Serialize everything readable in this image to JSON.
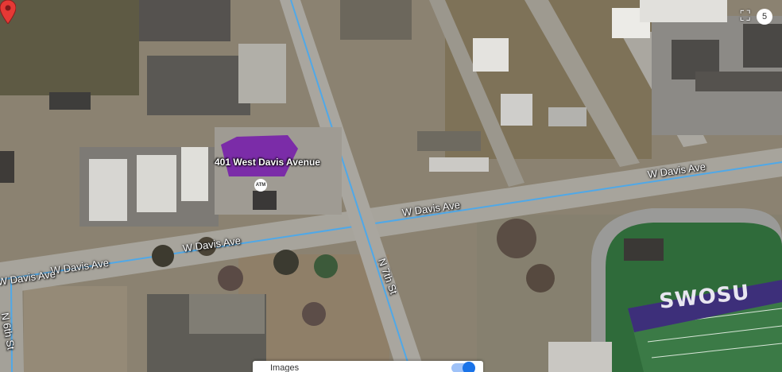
{
  "map": {
    "type": "satellite",
    "pin": {
      "address": "401 West Davis Avenue",
      "color": "#e53935"
    },
    "atm_label": "ATM",
    "streets": [
      {
        "name": "W Davis Ave",
        "id": "w-davis-ave-east"
      },
      {
        "name": "W Davis Ave",
        "id": "w-davis-ave-center"
      },
      {
        "name": "W Davis Ave",
        "id": "w-davis-ave-west"
      },
      {
        "name": "W Davis Ave",
        "id": "w-davis-ave-left-edge"
      },
      {
        "name": "N 7th St",
        "id": "n-7th-st"
      },
      {
        "name": "N 6th St",
        "id": "n-6th-st"
      }
    ],
    "stadium_text": "SWOSU",
    "photo_count": "5",
    "fullscreen_icon": "fullscreen-icon",
    "imagery_label": "Images"
  },
  "colors": {
    "road": "#a7a49c",
    "route_line": "#4fa8e8",
    "field": "#2f6b3a",
    "track": "#9a9a98",
    "roof_purple": "#7b2ca8",
    "toggle": "#1a73e8"
  }
}
